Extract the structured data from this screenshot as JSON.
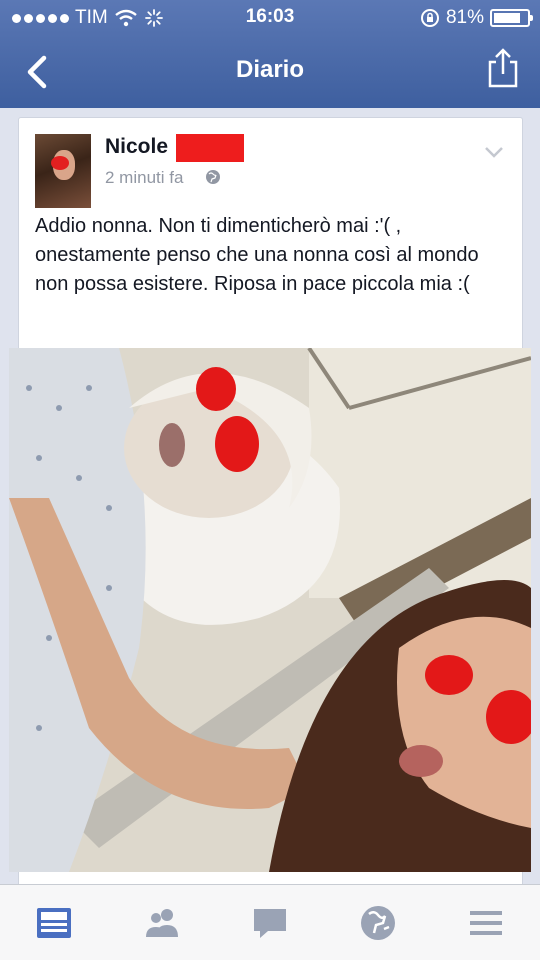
{
  "status_bar": {
    "carrier": "TIM",
    "time": "16:03",
    "battery_percent": "81%",
    "battery_level": 0.81,
    "signal_bars": 5
  },
  "nav": {
    "title": "Diario",
    "back_icon": "chevron-left-icon",
    "share_icon": "share-icon"
  },
  "post": {
    "author": "Nicole",
    "timestamp": "2 minuti fa",
    "privacy_icon": "globe-icon",
    "text": "Addio nonna. Non ti dimenticherò mai :'( , onestamente penso che una nonna così al mondo non possa esistere. Riposa in pace piccola mia :("
  },
  "tab_bar": {
    "items": [
      {
        "icon": "news-feed-icon",
        "active": true
      },
      {
        "icon": "friend-requests-icon",
        "active": false
      },
      {
        "icon": "messages-icon",
        "active": false
      },
      {
        "icon": "notifications-globe-icon",
        "active": false
      },
      {
        "icon": "menu-icon",
        "active": false
      }
    ]
  },
  "colors": {
    "brand": "#3e5f9f",
    "active_tab": "#4a6fc1",
    "inactive_tab": "#9aa3b5",
    "redaction": "#e32020"
  }
}
